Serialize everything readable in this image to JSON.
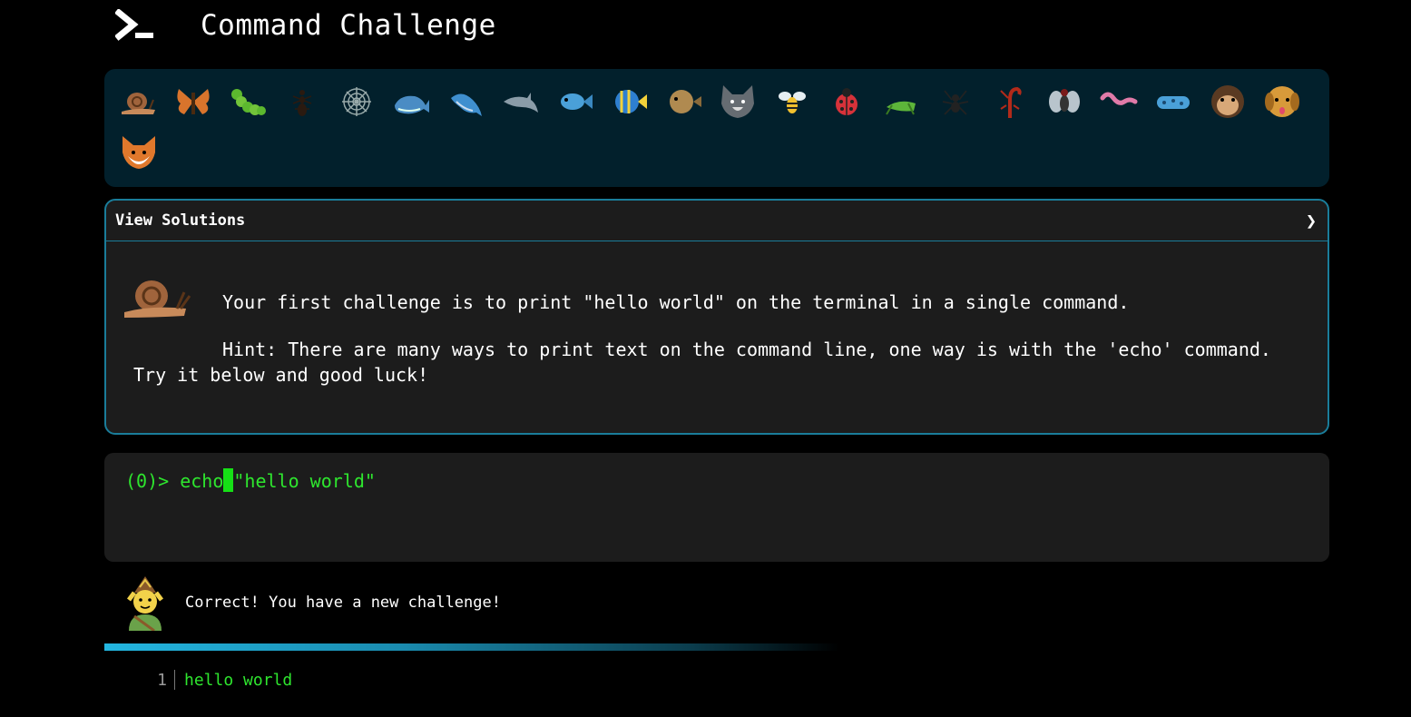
{
  "header": {
    "title": "Command Challenge",
    "logo_icon": "terminal-prompt-icon"
  },
  "emoji_bar": {
    "items": [
      {
        "icon": "snail-icon"
      },
      {
        "icon": "butterfly-icon"
      },
      {
        "icon": "caterpillar-icon"
      },
      {
        "icon": "ant-icon"
      },
      {
        "icon": "spider-web-icon"
      },
      {
        "icon": "whale-icon"
      },
      {
        "icon": "spouting-whale-icon"
      },
      {
        "icon": "dolphin-icon"
      },
      {
        "icon": "fish-icon"
      },
      {
        "icon": "tropical-fish-icon"
      },
      {
        "icon": "blowfish-icon"
      },
      {
        "icon": "wolf-icon"
      },
      {
        "icon": "bee-icon"
      },
      {
        "icon": "ladybug-icon"
      },
      {
        "icon": "cricket-icon"
      },
      {
        "icon": "spider-icon"
      },
      {
        "icon": "scorpion-icon"
      },
      {
        "icon": "fly-icon"
      },
      {
        "icon": "worm-icon"
      },
      {
        "icon": "microbe-icon"
      },
      {
        "icon": "monkey-face-icon"
      },
      {
        "icon": "dog-face-icon"
      },
      {
        "icon": "fox-face-icon"
      }
    ]
  },
  "solutions": {
    "title": "View Solutions",
    "chevron": "❯",
    "challenge": "Your first challenge is to print \"hello world\" on the terminal in a single command.",
    "hint": "Hint: There are many ways to print text on the command line, one way is with the 'echo' command. Try it below and good luck!"
  },
  "terminal": {
    "prompt": "(0)> ",
    "command_before_cursor": "echo",
    "command_after_cursor": "\"hello world\""
  },
  "feedback": {
    "icon": "elf-icon",
    "text": "Correct! You have a new challenge!"
  },
  "output": {
    "lines": [
      {
        "number": "1",
        "text": "hello world"
      }
    ]
  },
  "colors": {
    "accent": "#1a7d9a",
    "terminal_green": "#2ee62e",
    "emoji_bar_bg": "#02202c",
    "panel_bg": "#1c1c1c"
  }
}
